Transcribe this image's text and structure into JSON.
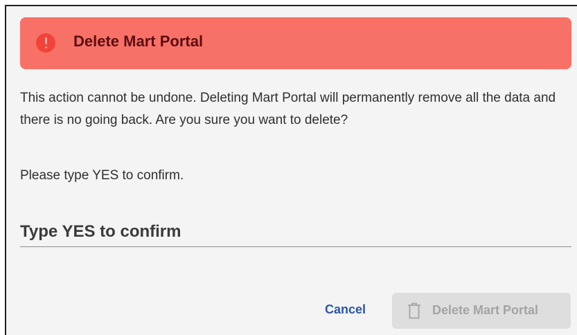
{
  "dialog": {
    "title": "Delete Mart Portal",
    "message": "This action cannot be undone. Deleting Mart Portal will permanently remove all the data and there is no going back. Are you sure you want to delete?",
    "confirm_hint": "Please type YES to confirm.",
    "input": {
      "placeholder": "Type YES to confirm",
      "value": ""
    },
    "cancel_label": "Cancel",
    "delete_label": "Delete Mart Portal",
    "delete_enabled": false
  },
  "icons": {
    "banner": "alert-circle-icon",
    "delete": "trash-icon"
  },
  "colors": {
    "banner_bg": "#f87166",
    "banner_icon": "#f0433a",
    "title_text": "#5a0e12",
    "link": "#2a57a6",
    "disabled_bg": "#dedede",
    "disabled_text": "#a4a4a4"
  }
}
